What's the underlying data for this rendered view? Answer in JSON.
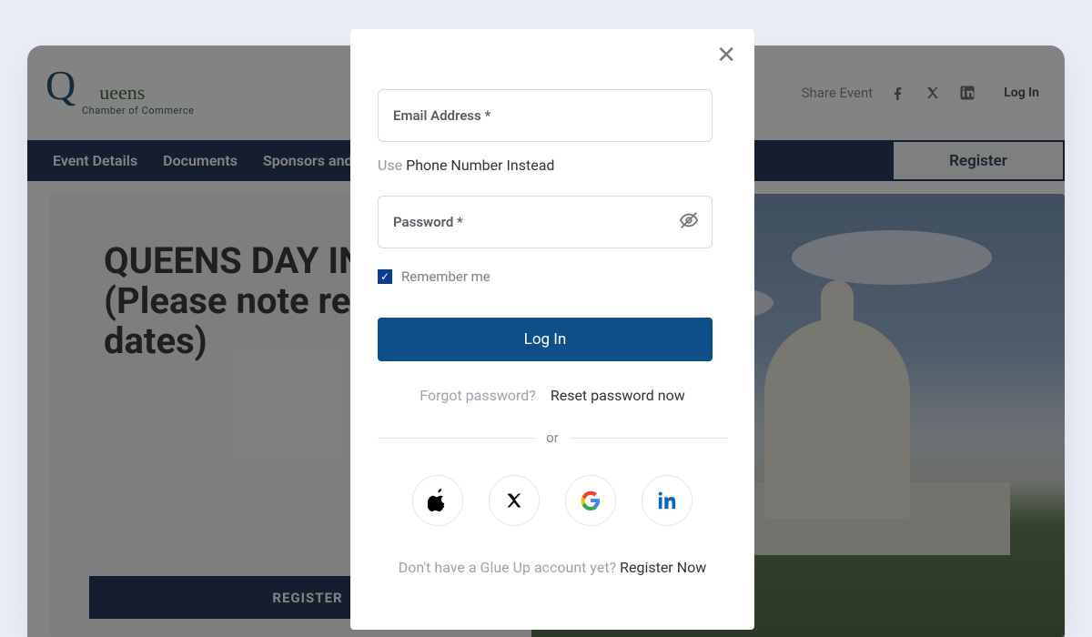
{
  "header": {
    "logo_main": "ueens",
    "logo_sub": "Chamber of Commerce",
    "share_label": "Share Event",
    "login_label": "Log In"
  },
  "nav": {
    "items": [
      "Event Details",
      "Documents",
      "Sponsors and Pa"
    ],
    "register_label": "Register"
  },
  "event": {
    "title_line1": "QUEENS DAY IN",
    "title_line2": "(Please note re",
    "title_line3": "dates)",
    "register_button": "REGISTER"
  },
  "modal": {
    "email_label": "Email Address *",
    "use_phone_prefix": "Use ",
    "use_phone_link": "Phone Number Instead",
    "password_label": "Password *",
    "remember_label": "Remember me",
    "login_button": "Log In",
    "forgot_label": "Forgot password?",
    "reset_link": "Reset password now",
    "divider": "or",
    "no_account_label": "Don't have a Glue Up account yet? ",
    "register_now": "Register Now"
  },
  "social": {
    "apple": "apple",
    "x": "x",
    "google": "google",
    "linkedin": "linkedin"
  }
}
